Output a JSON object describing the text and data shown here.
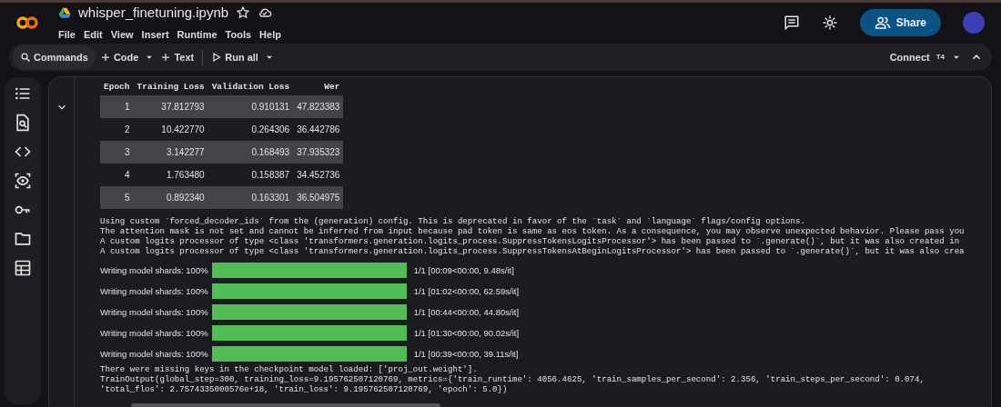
{
  "notebook": {
    "title": "whisper_finetuning.ipynb",
    "starred": false
  },
  "menu": [
    "File",
    "Edit",
    "View",
    "Insert",
    "Runtime",
    "Tools",
    "Help"
  ],
  "header_actions": {
    "share": "Share"
  },
  "toolbar": {
    "commands": "Commands",
    "code": "Code",
    "text": "Text",
    "run_all": "Run all",
    "connect": "Connect",
    "runtime_type": "T4"
  },
  "sidebar": {
    "items": [
      {
        "kind": "toc"
      },
      {
        "kind": "find"
      },
      {
        "kind": "code"
      },
      {
        "kind": "variables"
      },
      {
        "kind": "secrets"
      },
      {
        "kind": "files"
      },
      {
        "kind": "data"
      }
    ]
  },
  "cell": {
    "expanded": true,
    "table": {
      "columns": [
        "Epoch",
        "Training Loss",
        "Validation Loss",
        "Wer"
      ],
      "rows": [
        [
          "1",
          "37.812793",
          "0.910131",
          "47.823383"
        ],
        [
          "2",
          "10.422770",
          "0.264306",
          "36.442786"
        ],
        [
          "3",
          "3.142277",
          "0.168493",
          "37.935323"
        ],
        [
          "4",
          "1.763480",
          "0.158387",
          "34.452736"
        ],
        [
          "5",
          "0.892340",
          "0.163301",
          "36.504975"
        ]
      ]
    },
    "log_lines": [
      "Using custom `forced_decoder_ids` from the (generation) config. This is deprecated in favor of the `task` and `language` flags/config options.",
      "The attention mask is not set and cannot be inferred from input because pad token is same as eos token. As a consequence, you may observe unexpected behavior. Please pass you",
      "A custom logits processor of type <class 'transformers.generation.logits_process.SuppressTokensLogitsProcessor'> has been passed to `.generate()`, but it was also created in",
      "A custom logits processor of type <class 'transformers.generation.logits_process.SuppressTokensAtBeginLogitsProcessor'> has been passed to `.generate()`, but it was also crea"
    ],
    "progress": [
      {
        "label": "Writing model shards: 100%",
        "level": 1.0,
        "stats": "1/1 [00:09<00:00,  9.48s/it]"
      },
      {
        "label": "Writing model shards: 100%",
        "level": 1.0,
        "stats": "1/1 [01:02<00:00, 62.59s/it]"
      },
      {
        "label": "Writing model shards: 100%",
        "level": 1.0,
        "stats": "1/1 [00:44<00:00, 44.80s/it]"
      },
      {
        "label": "Writing model shards: 100%",
        "level": 1.0,
        "stats": "1/1 [01:30<00:00, 90.02s/it]"
      },
      {
        "label": "Writing model shards: 100%",
        "level": 1.0,
        "stats": "1/1 [00:39<00:00, 39.11s/it]"
      }
    ],
    "result_lines": [
      "There were missing keys in the checkpoint model loaded: ['proj_out.weight'].",
      "TrainOutput(global_step=300, training_loss=9.195762507120769, metrics={'train_runtime': 4056.4625, 'train_samples_per_second': 2.356, 'train_steps_per_second': 0.074,",
      "'total_flos': 2.7574335000576e+18, 'train_loss': 9.195762507120769, 'epoch': 5.0})"
    ]
  }
}
